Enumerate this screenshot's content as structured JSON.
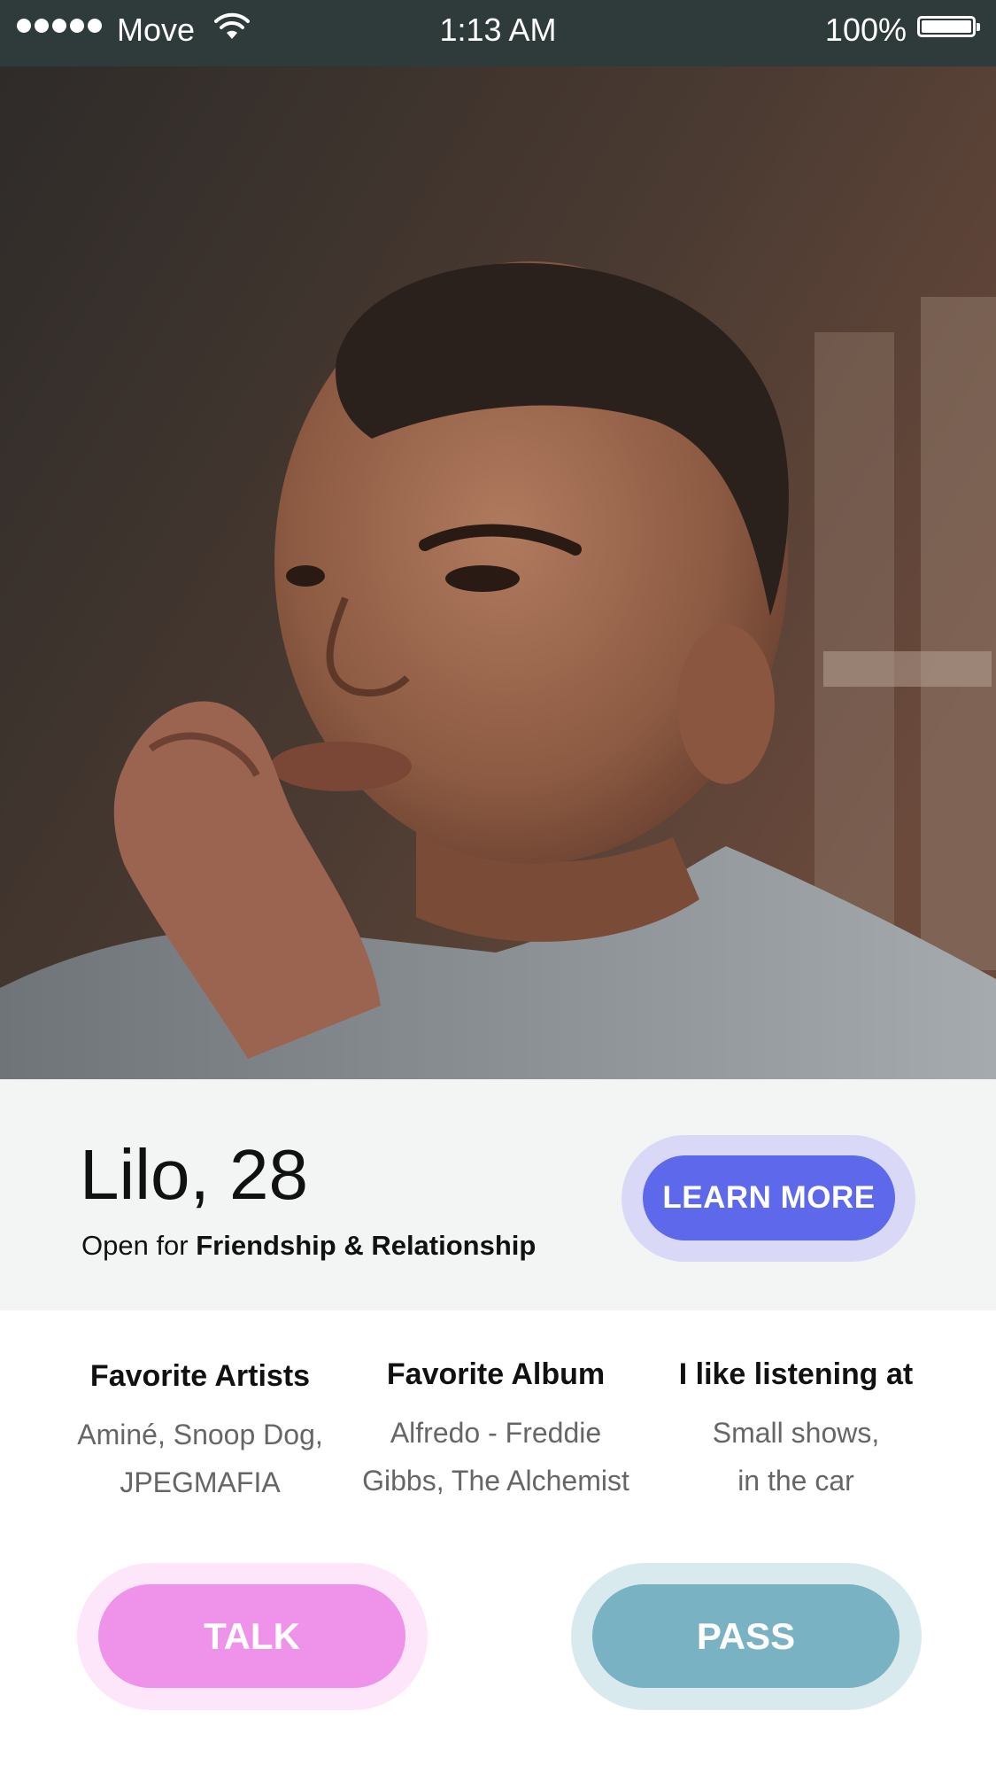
{
  "status_bar": {
    "carrier": "Move",
    "time": "1:13 AM",
    "battery_percent": "100%"
  },
  "profile": {
    "photo_alt": "Profile photo",
    "name_age": "Lilo, 28",
    "intent_prefix": "Open for ",
    "intent_bold": "Friendship & Relationship",
    "learn_more_label": "LEARN MORE"
  },
  "favorites": [
    {
      "title": "Favorite Artists",
      "lines": [
        "Aminé, Snoop Dog,",
        "JPEGMAFIA"
      ]
    },
    {
      "title": "Favorite Album",
      "lines": [
        "Alfredo - Freddie",
        "Gibbs, The Alchemist"
      ]
    },
    {
      "title": "I like listening at",
      "lines": [
        "Small shows,",
        "in the car"
      ]
    }
  ],
  "actions": {
    "talk_label": "TALK",
    "pass_label": "PASS"
  },
  "colors": {
    "status_bar_bg": "#2f3b3a",
    "learn_more": "#5d68ea",
    "talk": "#ee93e9",
    "pass": "#79b2c3"
  }
}
